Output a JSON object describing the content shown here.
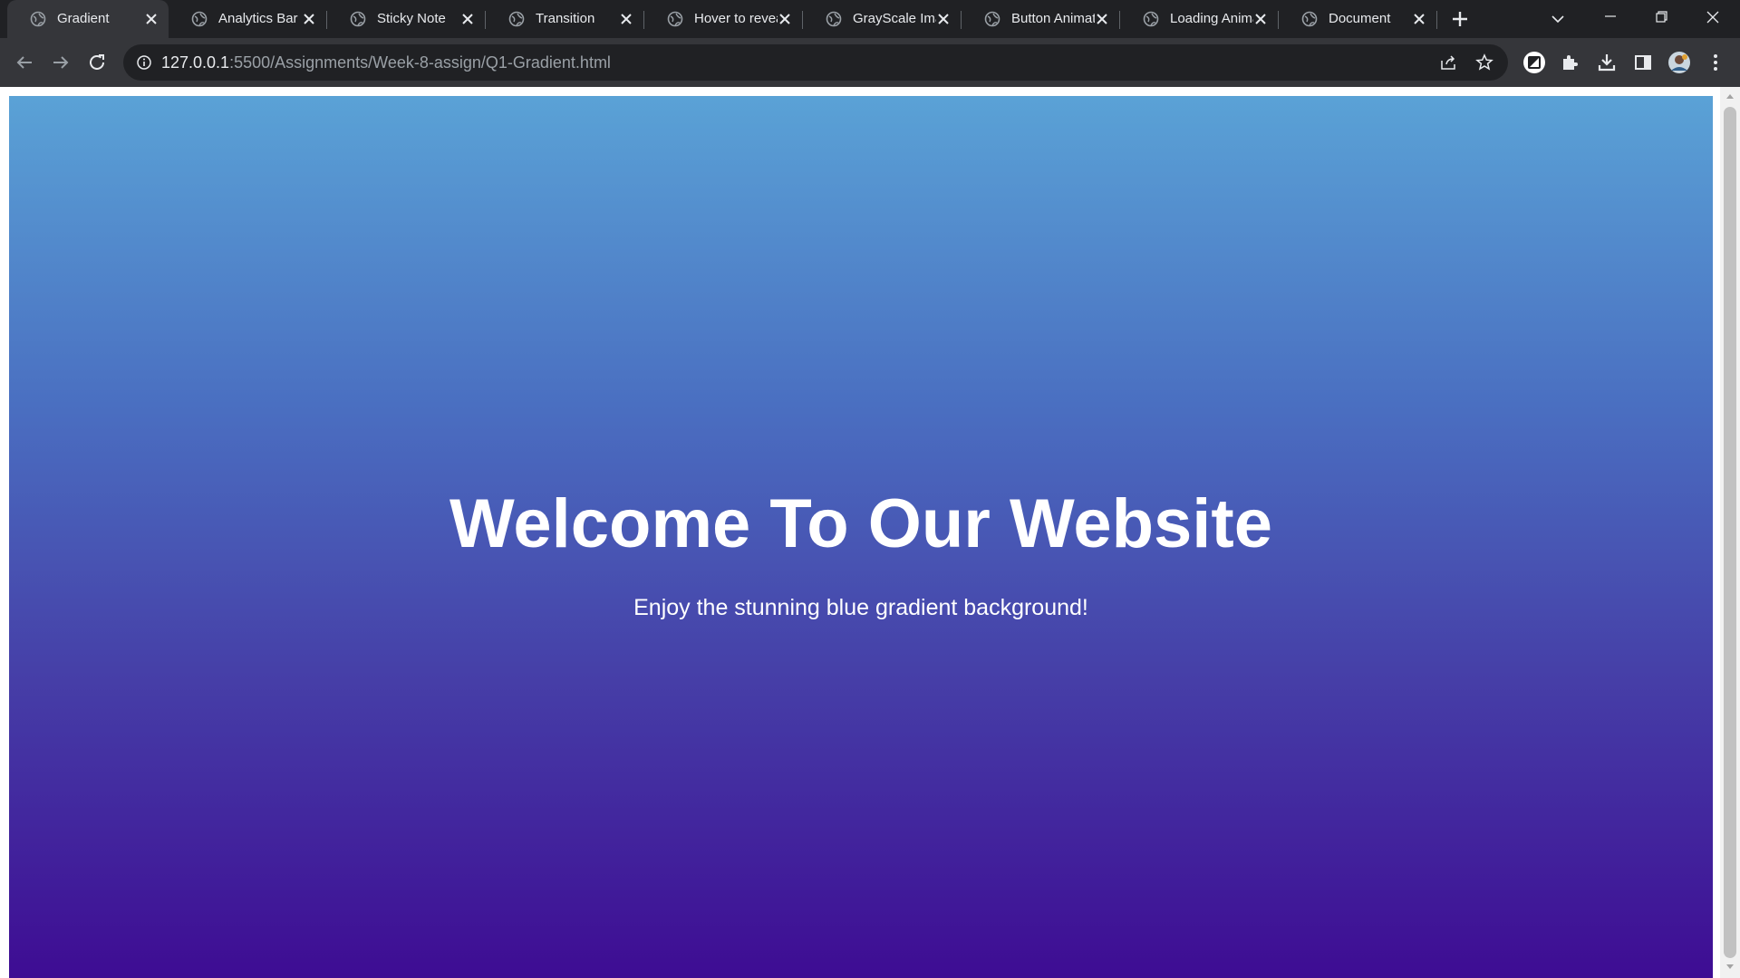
{
  "browser": {
    "tabs": [
      {
        "label": "Gradient",
        "active": true
      },
      {
        "label": "Analytics Bar",
        "active": false
      },
      {
        "label": "Sticky Note",
        "active": false
      },
      {
        "label": "Transition",
        "active": false
      },
      {
        "label": "Hover to reveal",
        "active": false
      },
      {
        "label": "GrayScale Image",
        "active": false
      },
      {
        "label": "Button Animation",
        "active": false
      },
      {
        "label": "Loading Animation",
        "active": false
      },
      {
        "label": "Document",
        "active": false
      }
    ],
    "url_host": "127.0.0.1",
    "url_rest": ":5500/Assignments/Week-8-assign/Q1-Gradient.html"
  },
  "page": {
    "heading": "Welcome To Our Website",
    "subtitle": "Enjoy the stunning blue gradient background!"
  },
  "colors": {
    "gradient_top": "#5aa2d6",
    "gradient_bottom": "#3e0c93",
    "chrome_dark": "#202124",
    "chrome_toolbar": "#35363a"
  }
}
